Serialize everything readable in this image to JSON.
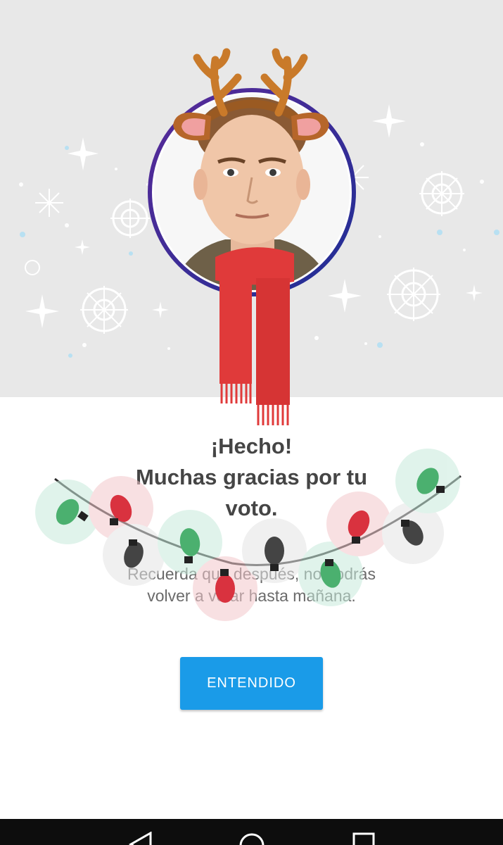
{
  "dialog": {
    "title_line1": "¡Hecho!",
    "title_line2": "Muchas gracias por tu",
    "title_line3": "voto.",
    "message_line1": "Recuerda que después, no podrás",
    "message_line2": "volver a votar hasta mañana.",
    "button_label": "ENTENDIDO"
  },
  "navbar": {
    "icons": [
      "back-icon",
      "home-icon",
      "recents-icon"
    ]
  },
  "colors": {
    "hero_background": "#e8e8e8",
    "accent_button": "#1a9be8",
    "title_text": "#454545",
    "message_text": "#6a6a6a",
    "scarf_red": "#e03a3a",
    "antler_brown": "#c97a2a",
    "avatar_ring": "#3b2a8f",
    "navbar": "#0d0d0d"
  }
}
